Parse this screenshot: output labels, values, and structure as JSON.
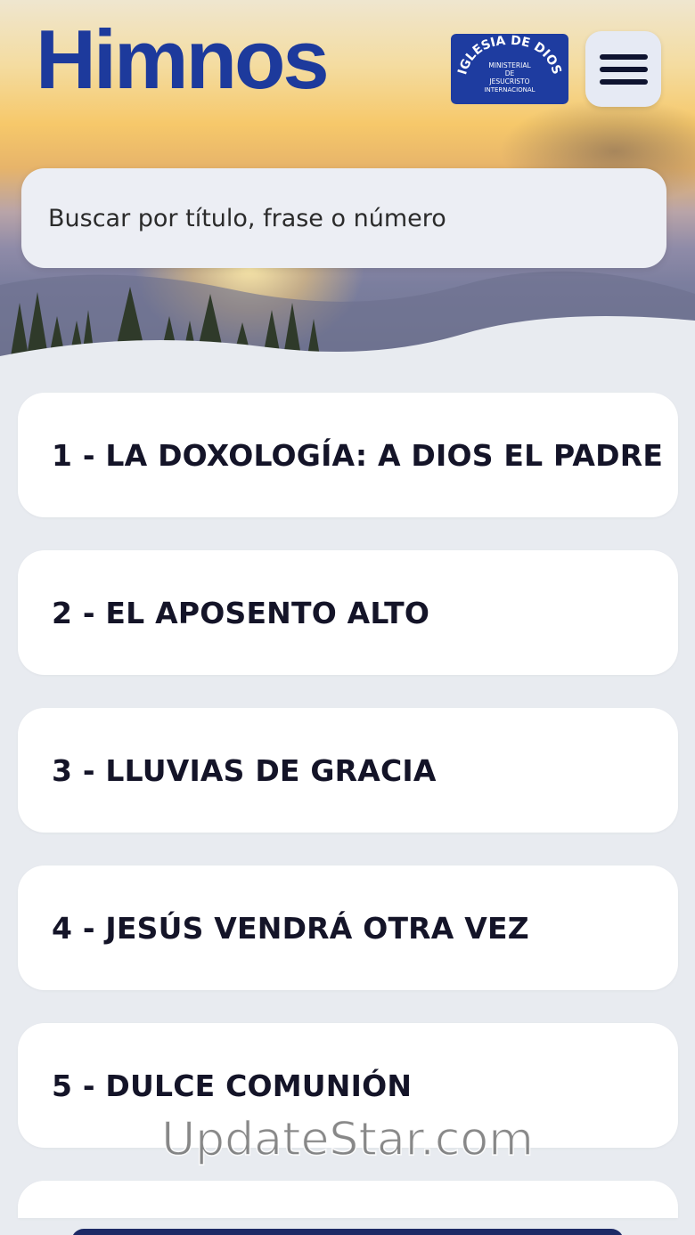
{
  "header": {
    "title": "Himnos",
    "logo_text": {
      "arc": "IGLESIA DE DIOS",
      "line1": "MINISTERIAL",
      "line2": "DE",
      "line3": "JESUCRISTO",
      "line4": "INTERNACIONAL"
    },
    "menu_icon": "hamburger-menu-icon"
  },
  "search": {
    "placeholder": "Buscar por título, frase o número",
    "value": ""
  },
  "hymns": [
    {
      "label": "1 - LA DOXOLOGÍA: A DIOS EL PADRE"
    },
    {
      "label": "2 - EL APOSENTO ALTO"
    },
    {
      "label": "3 - LLUVIAS DE GRACIA"
    },
    {
      "label": "4 - JESÚS VENDRÁ OTRA VEZ"
    },
    {
      "label": "5 - DULCE COMUNIÓN"
    }
  ],
  "watermark": "UpdateStar.com",
  "colors": {
    "brand_blue": "#1d3a9c",
    "background": "#e8ebf0",
    "card": "#ffffff",
    "text": "#141428"
  }
}
